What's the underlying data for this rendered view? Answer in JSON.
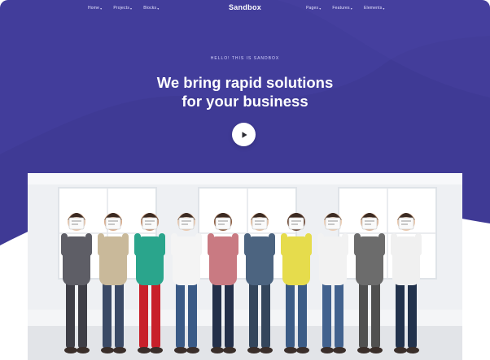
{
  "brand": {
    "name": "Sandbox"
  },
  "nav": {
    "left": [
      {
        "label": "Home"
      },
      {
        "label": "Projects"
      },
      {
        "label": "Blocks"
      }
    ],
    "right": [
      {
        "label": "Pages"
      },
      {
        "label": "Features"
      },
      {
        "label": "Elements"
      }
    ]
  },
  "hero": {
    "eyebrow": "HELLO! THIS IS SANDBOX",
    "headline_line1": "We bring rapid solutions",
    "headline_line2": "for your business",
    "play_icon": "play-icon"
  },
  "colors": {
    "hero_bg": "#3f3a95",
    "hero_bg_light": "#4a45a3",
    "page_bg": "#ffffff",
    "text_light": "#e6e4ff"
  },
  "photo": {
    "subject": "team-photo",
    "people": [
      {
        "top": "#5e5e66",
        "bottom": "#3e3e46"
      },
      {
        "top": "#c9b99a",
        "bottom": "#3b4a66"
      },
      {
        "top": "#2aa58c",
        "bottom": "#c8202a"
      },
      {
        "top": "#f4f4f4",
        "bottom": "#3a5a86"
      },
      {
        "top": "#c97a82",
        "bottom": "#24304a"
      },
      {
        "top": "#4c6480",
        "bottom": "#34465c"
      },
      {
        "top": "#e6dc4c",
        "bottom": "#3c5c86"
      },
      {
        "top": "#f2f2f2",
        "bottom": "#42628e"
      },
      {
        "top": "#6c6c6c",
        "bottom": "#505050"
      },
      {
        "top": "#f0f0f0",
        "bottom": "#22324c"
      }
    ]
  }
}
